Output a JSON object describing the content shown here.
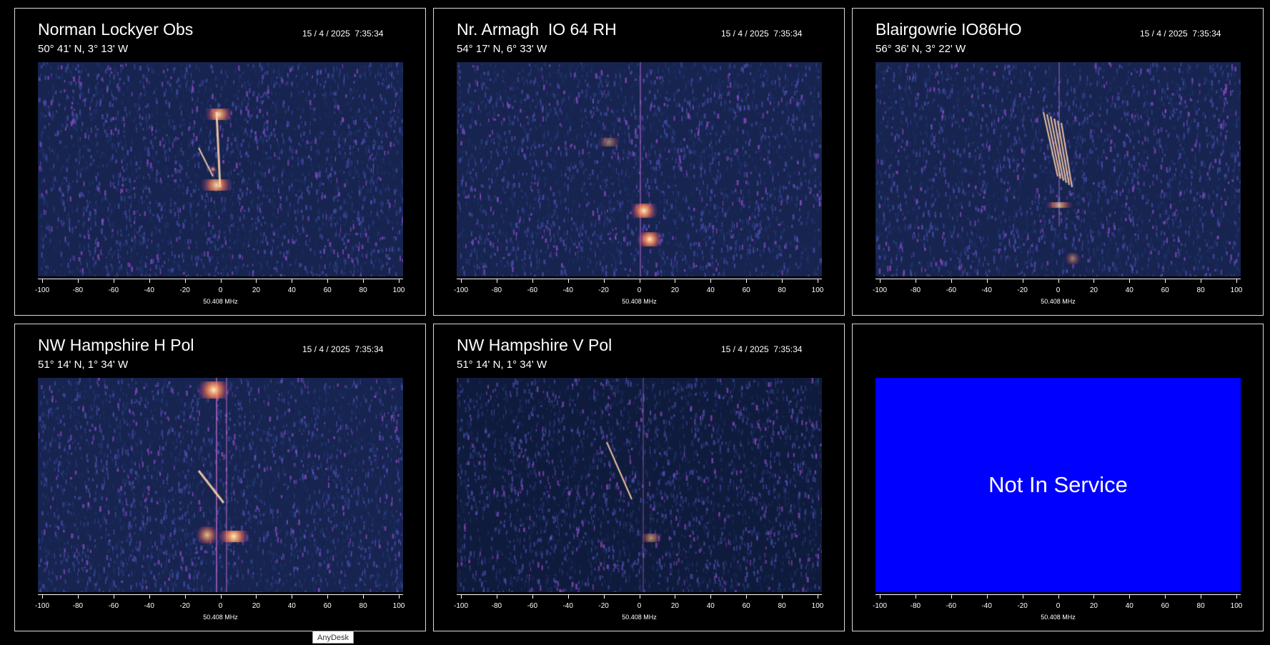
{
  "panels": [
    {
      "id": "norman",
      "title": "Norman Lockyer Obs",
      "coords": "50° 41' N, 3° 13' W",
      "timestamp": "15 / 4 / 2025  7:35:34",
      "status": "active"
    },
    {
      "id": "armagh",
      "title": "Nr. Armagh  IO 64 RH",
      "coords": "54° 17' N, 6° 33' W",
      "timestamp": "15 / 4 / 2025  7:35:34",
      "status": "active"
    },
    {
      "id": "blair",
      "title": "Blairgowrie IO86HO",
      "coords": "56° 36' N, 3° 22' W",
      "timestamp": "15 / 4 / 2025  7:35:34",
      "status": "active"
    },
    {
      "id": "nwh-h",
      "title": "NW Hampshire H Pol",
      "coords": "51° 14' N, 1° 34' W",
      "timestamp": "15 / 4 / 2025  7:35:34",
      "status": "active"
    },
    {
      "id": "nwh-v",
      "title": "NW Hampshire V Pol",
      "coords": "51° 14' N, 1° 34' W",
      "timestamp": "15 / 4 / 2025  7:35:34",
      "status": "active"
    },
    {
      "id": "nis",
      "title": "",
      "coords": "",
      "timestamp": "",
      "status": "not-in-service",
      "message": "Not In Service"
    }
  ],
  "axis": {
    "ticks": [
      "-100",
      "-80",
      "-60",
      "-40",
      "-20",
      "0",
      "20",
      "40",
      "60",
      "80",
      "100"
    ],
    "caption": "50.408 MHz"
  },
  "colors": {
    "spectrogram_bg": "#14224c",
    "not_in_service_bg": "#0000fe",
    "accent_signal": "#ffe680"
  },
  "taskbar_tooltip": "AnyDesk"
}
